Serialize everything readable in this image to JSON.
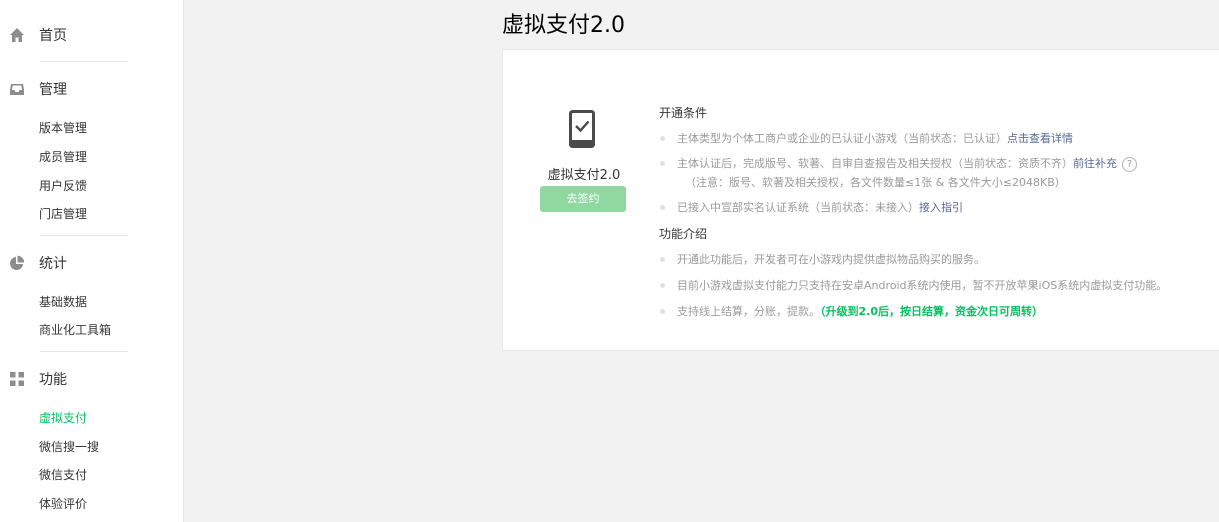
{
  "sidebar": {
    "home": "首页",
    "manage": {
      "label": "管理",
      "items": [
        "版本管理",
        "成员管理",
        "用户反馈",
        "门店管理"
      ]
    },
    "stats": {
      "label": "统计",
      "items": [
        "基础数据",
        "商业化工具箱"
      ]
    },
    "features": {
      "label": "功能",
      "items": [
        "虚拟支付",
        "微信搜一搜",
        "微信支付",
        "体验评价"
      ]
    },
    "active_item": "虚拟支付",
    "accent_color": "#07c160"
  },
  "page": {
    "title": "虚拟支付2.0"
  },
  "card": {
    "feature_name": "虚拟支付2.0",
    "sign_button": "去签约",
    "conditions_title": "开通条件",
    "conditions": [
      {
        "text": "主体类型为个体工商户或企业的已认证小游戏（当前状态：已认证）",
        "link": "点击查看详情"
      },
      {
        "text": "主体认证后，完成版号、软著、自审自查报告及相关授权（当前状态：资质不齐）",
        "link": "前往补充",
        "help": "?",
        "note": "（注意：版号、软著及相关授权，各文件数量≤1张 & 各文件大小≤2048KB）"
      },
      {
        "text": "已接入中宣部实名认证系统（当前状态：未接入）",
        "link": "接入指引"
      }
    ],
    "intro_title": "功能介绍",
    "intro": [
      {
        "text": "开通此功能后，开发者可在小游戏内提供虚拟物品购买的服务。"
      },
      {
        "text": "目前小游戏虚拟支付能力只支持在安卓Android系统内使用，暂不开放苹果iOS系统内虚拟支付功能。"
      },
      {
        "text": "支持线上结算，分账，提款。",
        "highlight": "（升级到2.0后，按日结算，资金次日可周转）"
      }
    ]
  }
}
